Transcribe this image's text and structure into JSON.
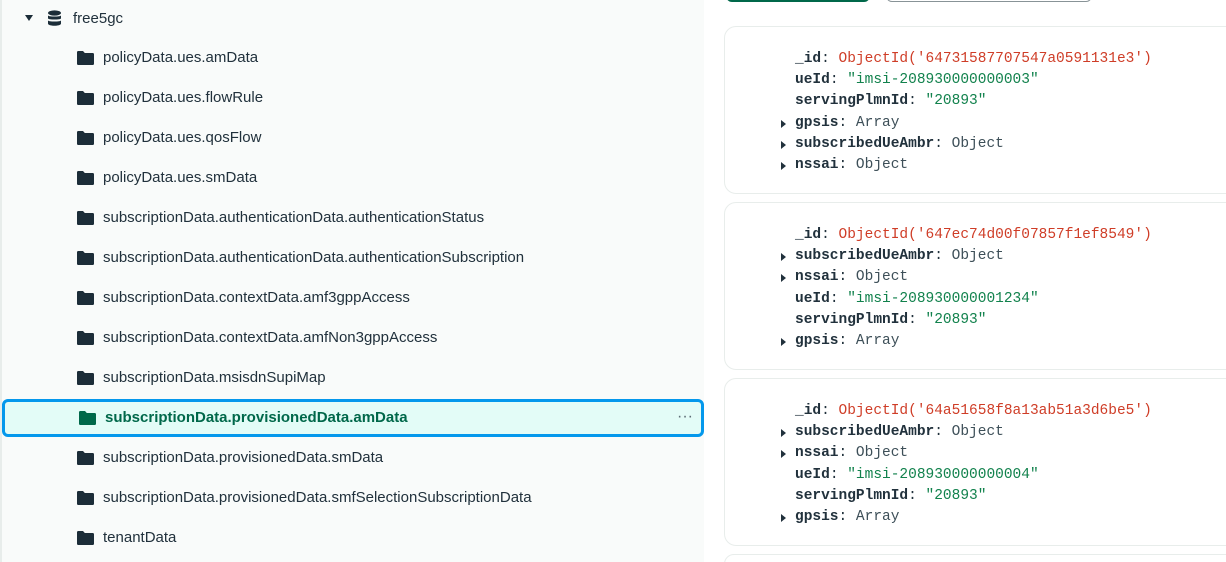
{
  "sidebar": {
    "database": {
      "name": "free5gc",
      "icon": "database-icon",
      "expanded": true
    },
    "collections": [
      {
        "name": "policyData.ues.amData"
      },
      {
        "name": "policyData.ues.flowRule"
      },
      {
        "name": "policyData.ues.qosFlow"
      },
      {
        "name": "policyData.ues.smData"
      },
      {
        "name": "subscriptionData.authenticationData.authenticationStatus"
      },
      {
        "name": "subscriptionData.authenticationData.authenticationSubscription"
      },
      {
        "name": "subscriptionData.contextData.amf3gppAccess"
      },
      {
        "name": "subscriptionData.contextData.amfNon3gppAccess"
      },
      {
        "name": "subscriptionData.msisdnSupiMap"
      },
      {
        "name": "subscriptionData.provisionedData.amData",
        "selected": true,
        "more": "···"
      },
      {
        "name": "subscriptionData.provisionedData.smData"
      },
      {
        "name": "subscriptionData.provisionedData.smfSelectionSubscriptionData"
      },
      {
        "name": "tenantData"
      }
    ]
  },
  "documents": [
    {
      "fields": [
        {
          "key": "_id",
          "value": "ObjectId('64731587707547a0591131e3')",
          "kind": "oid",
          "expandable": false
        },
        {
          "key": "ueId",
          "value": "\"imsi-208930000000003\"",
          "kind": "str",
          "expandable": false
        },
        {
          "key": "servingPlmnId",
          "value": "\"20893\"",
          "kind": "str",
          "expandable": false
        },
        {
          "key": "gpsis",
          "value": "Array",
          "kind": "type",
          "expandable": true
        },
        {
          "key": "subscribedUeAmbr",
          "value": "Object",
          "kind": "type",
          "expandable": true
        },
        {
          "key": "nssai",
          "value": "Object",
          "kind": "type",
          "expandable": true
        }
      ]
    },
    {
      "fields": [
        {
          "key": "_id",
          "value": "ObjectId('647ec74d00f07857f1ef8549')",
          "kind": "oid",
          "expandable": false
        },
        {
          "key": "subscribedUeAmbr",
          "value": "Object",
          "kind": "type",
          "expandable": true
        },
        {
          "key": "nssai",
          "value": "Object",
          "kind": "type",
          "expandable": true
        },
        {
          "key": "ueId",
          "value": "\"imsi-208930000001234\"",
          "kind": "str",
          "expandable": false
        },
        {
          "key": "servingPlmnId",
          "value": "\"20893\"",
          "kind": "str",
          "expandable": false
        },
        {
          "key": "gpsis",
          "value": "Array",
          "kind": "type",
          "expandable": true
        }
      ]
    },
    {
      "fields": [
        {
          "key": "_id",
          "value": "ObjectId('64a51658f8a13ab51a3d6be5')",
          "kind": "oid",
          "expandable": false
        },
        {
          "key": "subscribedUeAmbr",
          "value": "Object",
          "kind": "type",
          "expandable": true
        },
        {
          "key": "nssai",
          "value": "Object",
          "kind": "type",
          "expandable": true
        },
        {
          "key": "ueId",
          "value": "\"imsi-208930000000004\"",
          "kind": "str",
          "expandable": false
        },
        {
          "key": "servingPlmnId",
          "value": "\"20893\"",
          "kind": "str",
          "expandable": false
        },
        {
          "key": "gpsis",
          "value": "Array",
          "kind": "type",
          "expandable": true
        }
      ]
    }
  ],
  "colors": {
    "accent_green": "#00684a",
    "selected_bg": "#e3fcf7",
    "focus_border": "#0498ec",
    "object_id": "#cf3d27",
    "string_value": "#12824d"
  }
}
